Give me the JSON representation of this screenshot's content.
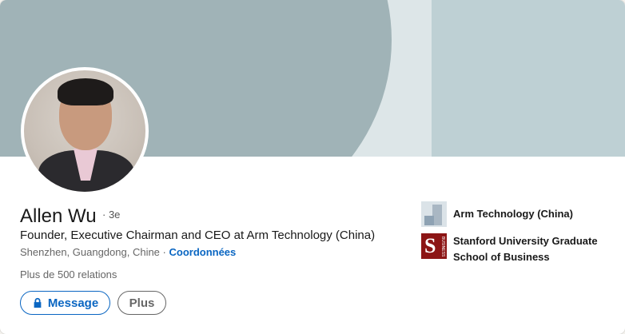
{
  "profile": {
    "name": "Allen Wu",
    "degree": "· 3e",
    "headline": "Founder, Executive Chairman and CEO at Arm Technology (China)",
    "location": "Shenzhen, Guangdong, Chine",
    "separator": " · ",
    "contact_link": "Coordonnées",
    "connections": "Plus de 500 relations"
  },
  "actions": {
    "message_label": "Message",
    "more_label": "Plus"
  },
  "organizations": [
    {
      "name": "Arm Technology (China)",
      "icon": "company-logo-arm"
    },
    {
      "name": "Stanford University Graduate School of Business",
      "icon": "school-logo-stanford"
    }
  ],
  "colors": {
    "accent": "#0a66c2",
    "banner_dark": "#a0b3b7",
    "banner_light": "#bed0d4",
    "stanford_red": "#8c1515"
  }
}
